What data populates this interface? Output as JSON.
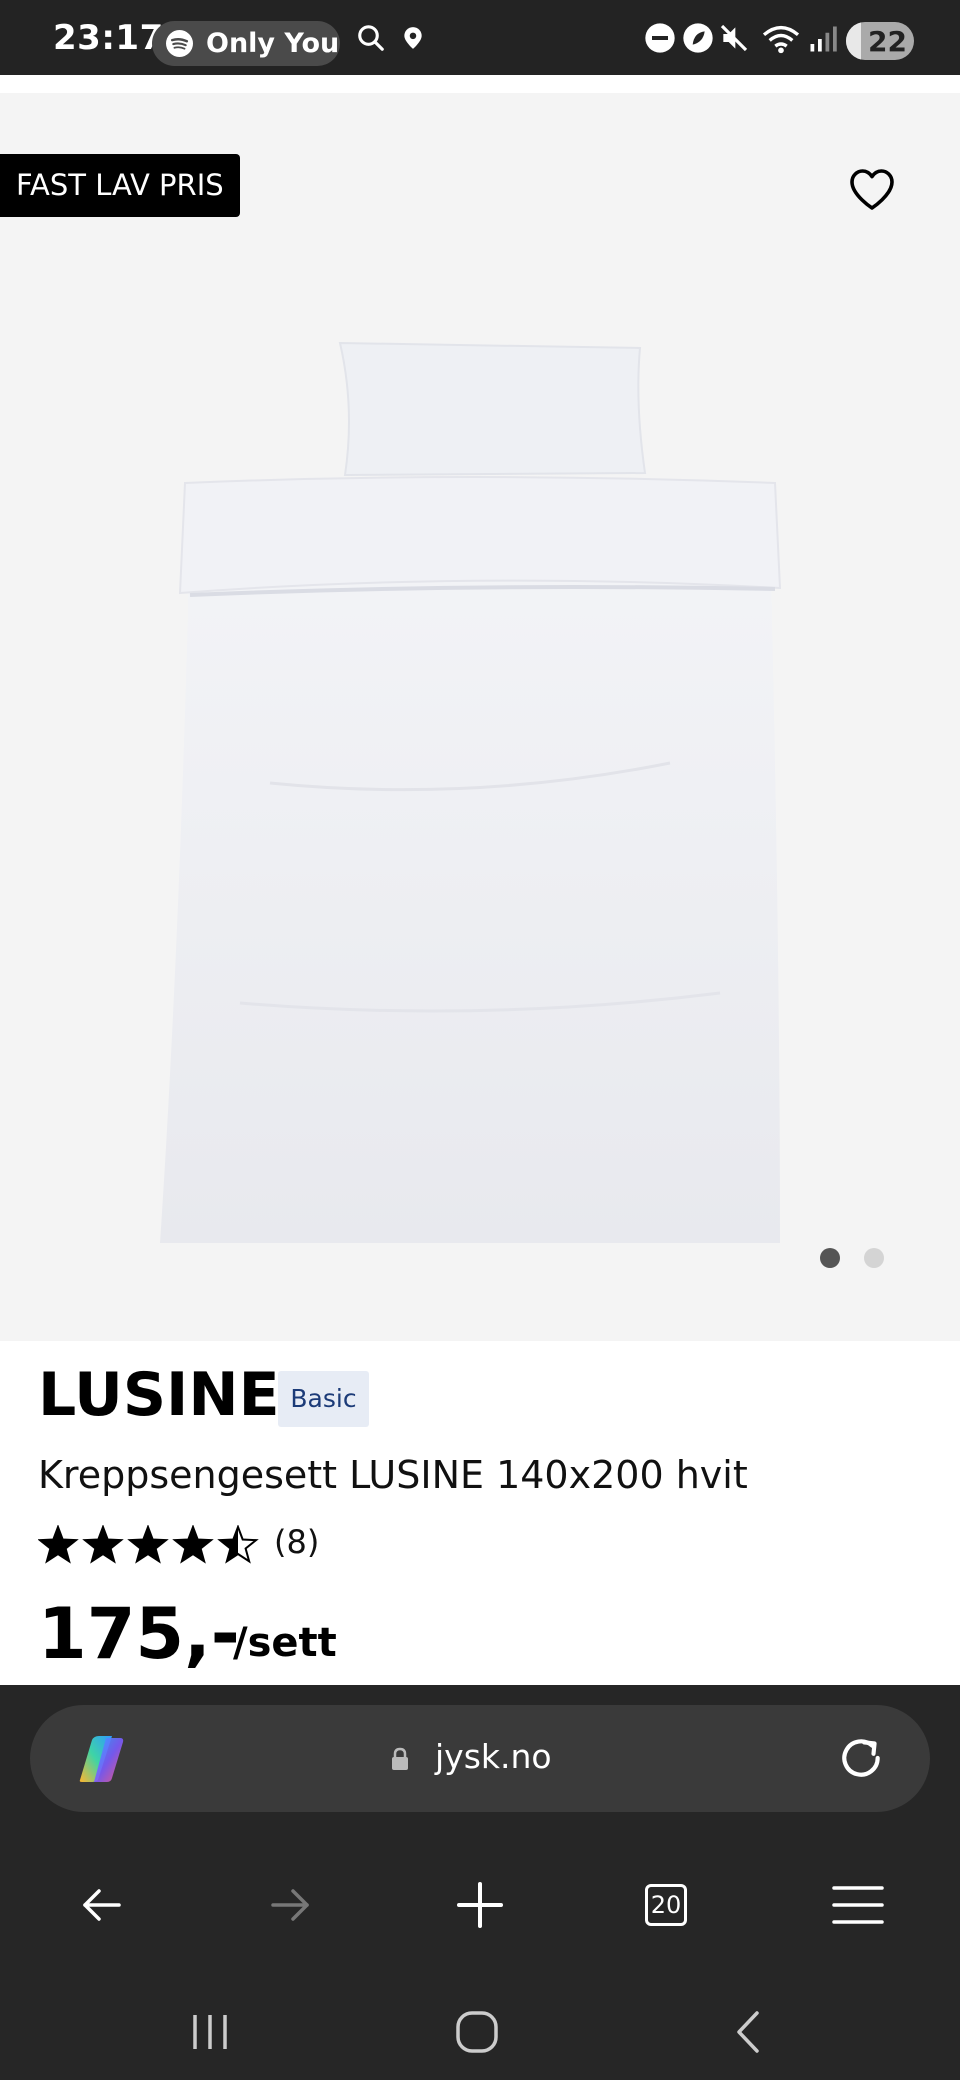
{
  "status_bar": {
    "time": "23:17",
    "now_playing": "Only You",
    "battery_level": "22",
    "battery_fraction": 0.22,
    "icons": [
      "spotify-icon",
      "search-icon",
      "location-icon",
      "dnd-icon",
      "leaf-icon",
      "mute-icon",
      "wifi-icon",
      "signal-icon",
      "battery-icon"
    ]
  },
  "product": {
    "badge": "FAST LAV PRIS",
    "brand": "LUSINE",
    "tier": "Basic",
    "name": "Kreppsengesett LUSINE 140x200 hvit",
    "rating": 4.5,
    "rating_count": "(8)",
    "price": "175,-",
    "unit": "/sett",
    "gallery_images": 2,
    "gallery_active": 1
  },
  "browser": {
    "url": "jysk.no",
    "tab_count": "20"
  },
  "colors": {
    "status_bar_bg": "#232323",
    "gallery_bg": "#f4f4f4",
    "badge_bg": "#000000",
    "tag_bg": "#e7ecf5",
    "tag_text": "#1c3b78",
    "browser_bg": "#262626",
    "urlbar_bg": "#3a3a3a"
  }
}
